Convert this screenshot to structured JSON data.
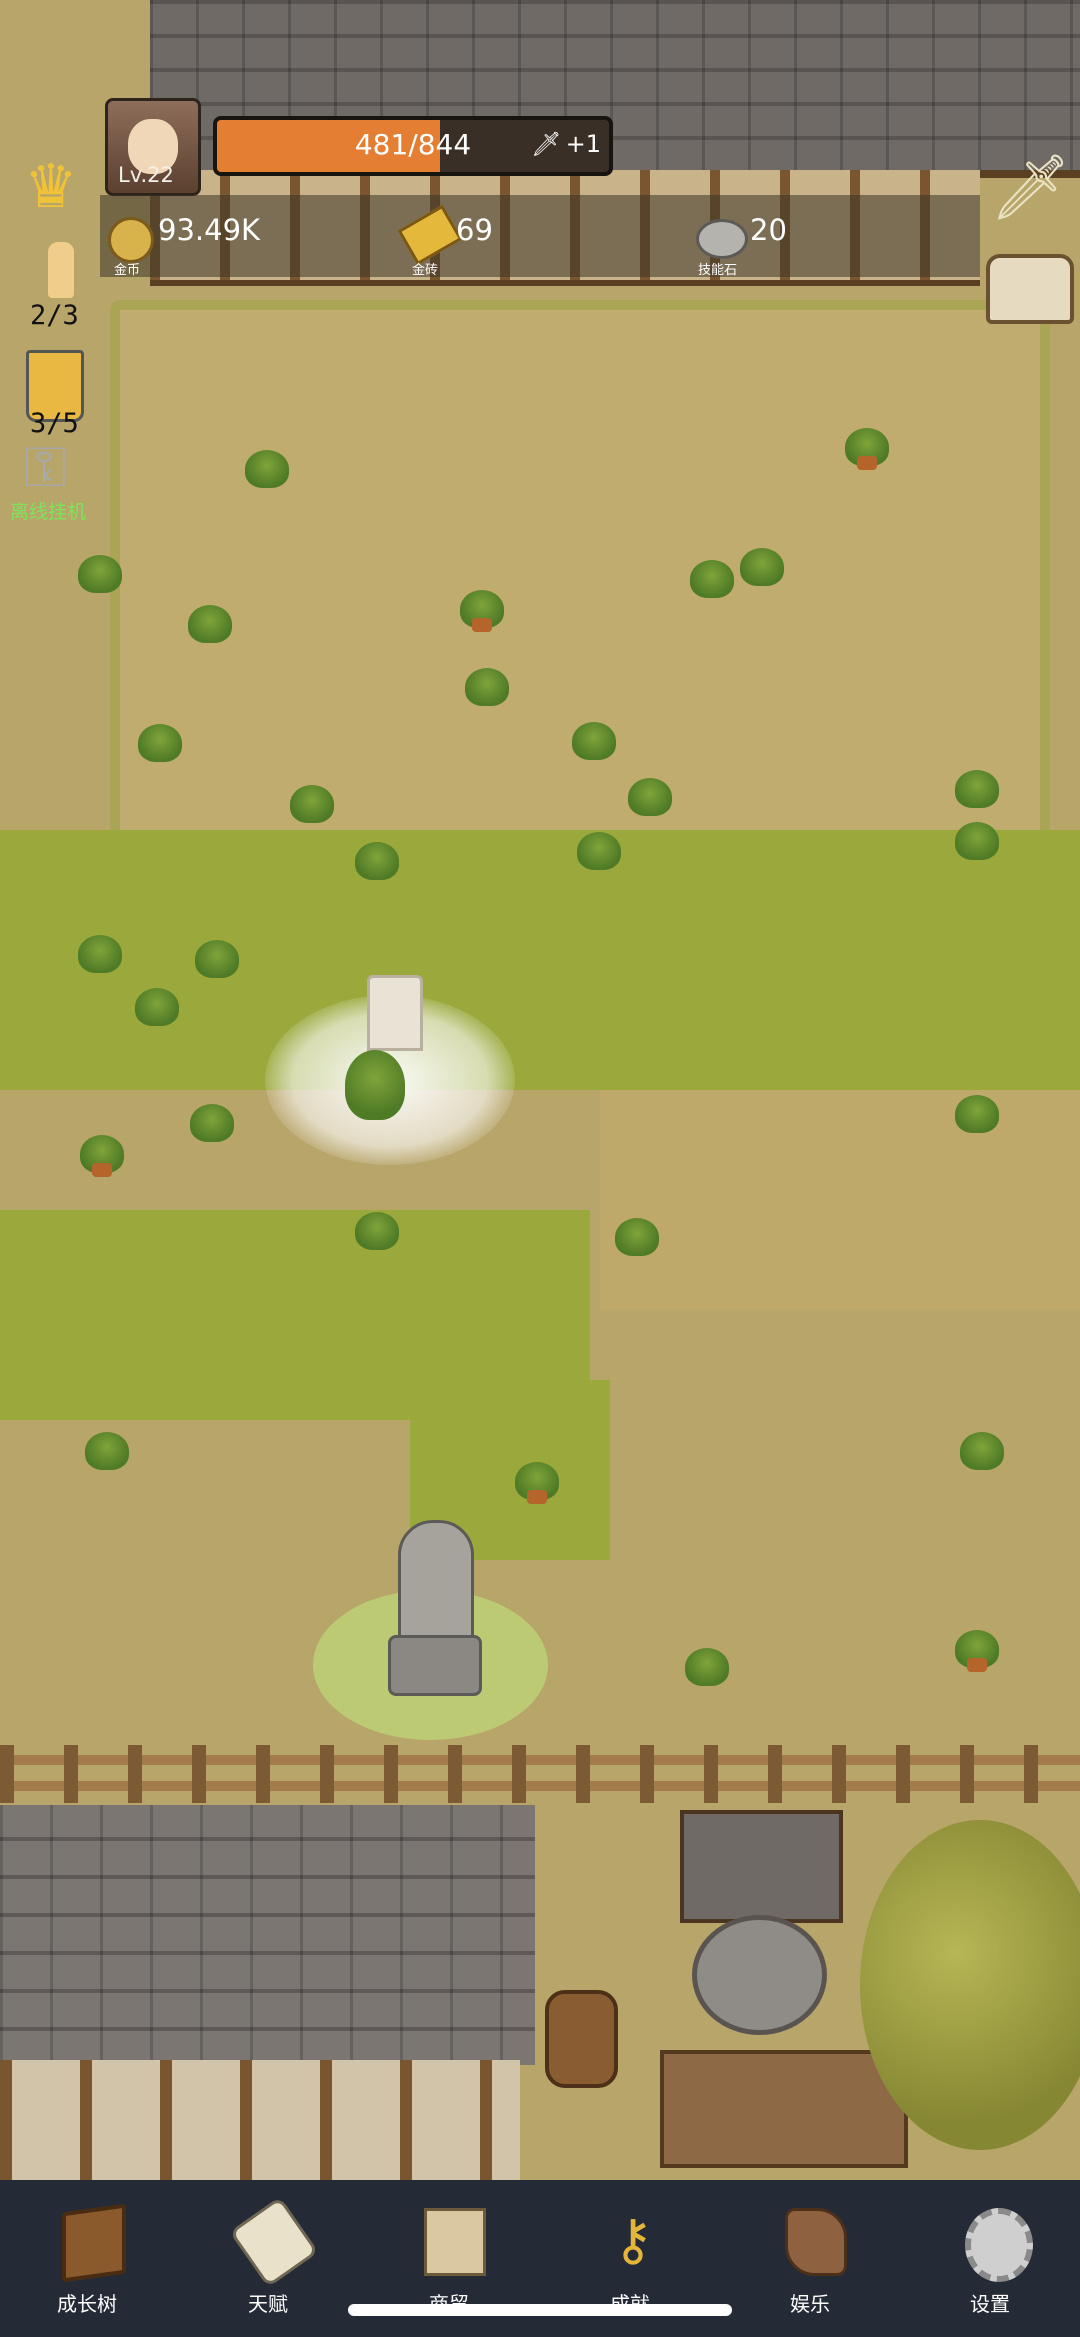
{
  "player": {
    "level": "Lv.22",
    "hp_text": "481/844",
    "hp_fraction": 0.57,
    "hp_bonus": "+1"
  },
  "resources": [
    {
      "icon": "gold-coin-icon",
      "value": "93.49K",
      "label": "金币"
    },
    {
      "icon": "gold-brick-icon",
      "value": "69",
      "label": "金砖"
    },
    {
      "icon": "skill-stone-icon",
      "value": "20",
      "label": "技能石"
    }
  ],
  "left_panel": {
    "candle_count": "2/3",
    "beer_count": "3/5",
    "idle_label": "离线挂机"
  },
  "nav": [
    {
      "label": "成长树",
      "icon": "growth-book-icon"
    },
    {
      "label": "天赋",
      "icon": "talent-scroll-icon"
    },
    {
      "label": "商贸",
      "icon": "trade-map-icon"
    },
    {
      "label": "成就",
      "icon": "achievement-key-icon"
    },
    {
      "label": "娱乐",
      "icon": "entertainment-leather-icon"
    },
    {
      "label": "设置",
      "icon": "settings-gear-icon"
    }
  ]
}
